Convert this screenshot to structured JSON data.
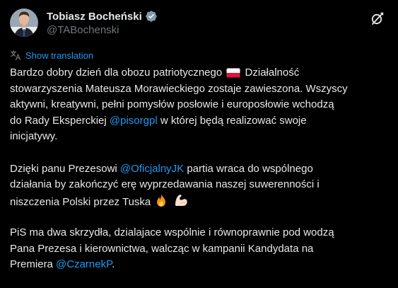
{
  "author": {
    "name": "Tobiasz Bocheński",
    "handle": "@TABochenski",
    "verified": true,
    "avatar_icon": "profile-photo"
  },
  "translation": {
    "label": "Show translation",
    "icon": "translate-icon"
  },
  "tweet": {
    "p1": {
      "l1a": "Bardzo dobry dzień dla obozu patriotycznego",
      "l1_emoji": "flag-poland",
      "l1b": "Działalność",
      "l2": "stowarzyszenia Mateusza Morawieckiego zostaje zawieszona. Wszyscy",
      "l3": "aktywni, kreatywni, pełni pomysłów posłowie i europosłowie wchodzą",
      "l4a": "do Rady Eksperckiej",
      "l4_mention": "@pisorgpl",
      "l4b": "w której będą realizować swoje",
      "l5": "inicjatywy."
    },
    "p2": {
      "l1a": "Dzięki panu Prezesowi",
      "l1_mention": "@OficjalnyJK",
      "l1b": "partia wraca do wspólnego",
      "l2": "działania by zakończyć erę wyprzedawania naszej suwerenności i",
      "l3": "niszczenia Polski przez Tuska",
      "l3_emojis": [
        "fire",
        "flexed-biceps"
      ]
    },
    "p3": {
      "l1": "PiS ma dwa skrzydła, dzialajace wspólnie i równoprawnie pod wodzą",
      "l2": "Pana Prezesa i kierownictwa, walcząc w kampanii Kandydata na",
      "l3a": "Premiera",
      "l3_mention": "@CzarnekP",
      "l3b": "."
    }
  },
  "colors": {
    "background": "#000000",
    "text": "#e7e9ea",
    "secondary": "#71767b",
    "link": "#1d9bf0",
    "verified": "#829aab"
  }
}
